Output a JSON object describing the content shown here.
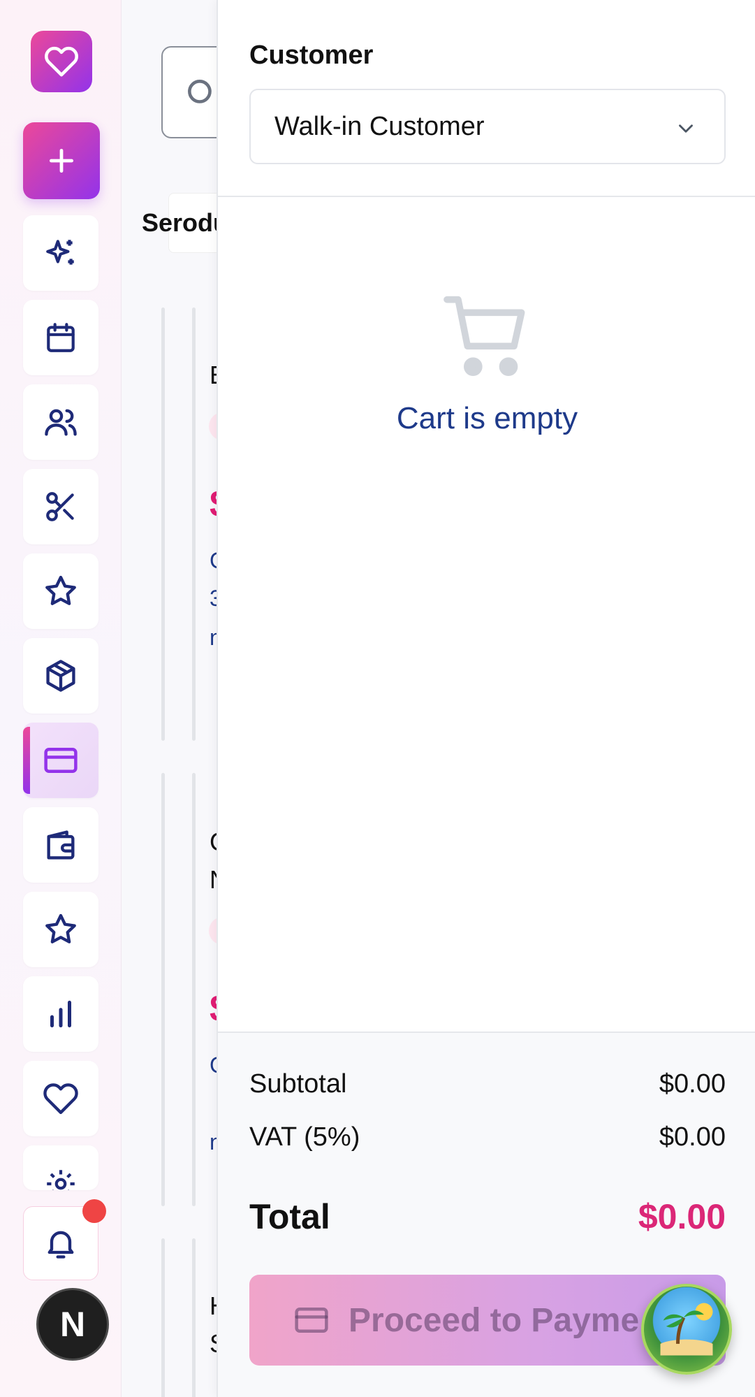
{
  "panel": {
    "customer_label": "Customer",
    "customer_value": "Walk-in Customer",
    "empty_text": "Cart is empty"
  },
  "summary": {
    "subtotal_label": "Subtotal",
    "subtotal_value": "$0.00",
    "vat_label": "VAT (5%)",
    "vat_value": "$0.00",
    "total_label": "Total",
    "total_value": "$0.00",
    "pay_button_label": "Proceed to Payme"
  },
  "main_peek": {
    "tabs_text": "Serodu",
    "card1_title": "E",
    "card1_price": "$",
    "card1_line1": "C",
    "card1_line2": "3",
    "card1_line3": "n",
    "card2_title_a": "C",
    "card2_title_b": "N",
    "card2_price": "$",
    "card2_line1": "C",
    "card2_line2": "⌄",
    "card2_line3": "n",
    "card3_title_a": "H",
    "card3_title_b": "S"
  },
  "sidebar": {
    "avatar_initial": "N",
    "notification_count_visible": true,
    "active_item": "pos",
    "items": [
      "ai-sparkles",
      "calendar",
      "customers",
      "services",
      "reviews",
      "inventory",
      "pos",
      "wallet",
      "loyalty",
      "reports",
      "favorites",
      "settings"
    ]
  },
  "colors": {
    "brand_pink": "#ec4899",
    "brand_purple": "#9333ea",
    "nav_icon": "#1e2a78",
    "total_accent": "#db2777",
    "text_blue": "#1e3a8a"
  }
}
